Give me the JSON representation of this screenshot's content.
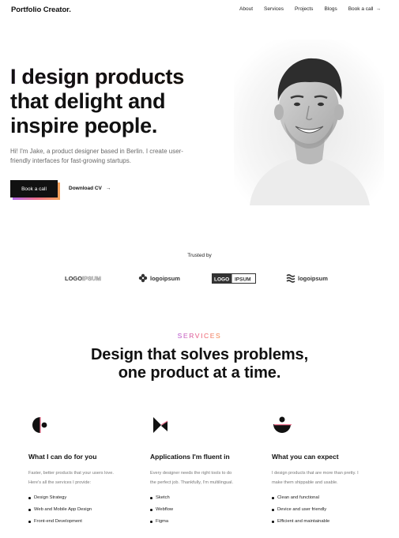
{
  "header": {
    "logo": "Portfolio Creator.",
    "nav": [
      "About",
      "Services",
      "Projects",
      "Blogs",
      "Book a call"
    ],
    "nav_cta_arrow": "→"
  },
  "hero": {
    "title_gradient": "I design products",
    "title_line2": "that delight and",
    "title_line3": "inspire people.",
    "subtitle": "Hi! I'm Jake, a product designer based in Berlin. I create user-friendly interfaces for fast-growing startups.",
    "primary_button": "Book a call",
    "secondary_button": "Download CV",
    "secondary_arrow": "→"
  },
  "trusted": {
    "label": "Trusted by",
    "logos": [
      "LOGOIPSUM",
      "logoipsum",
      "LOGO IPSUM",
      "logoipsum"
    ]
  },
  "services": {
    "eyebrow": "SERVICES",
    "title_line1": "Design that solves problems,",
    "title_line2": "one product at a time.",
    "columns": [
      {
        "icon": "half-circle-icon",
        "heading": "What I can do for you",
        "text": "Faster, better products that your users love. Here's all the services I provide:",
        "items": [
          "Design Strategy",
          "Web and Mobile App Design",
          "Front-end Development"
        ]
      },
      {
        "icon": "bowtie-icon",
        "heading": "Applications I'm fluent in",
        "text": "Every designer needs the right tools to do the perfect job. Thankfully, I'm multilingual.",
        "items": [
          "Sketch",
          "Webflow",
          "Figma"
        ]
      },
      {
        "icon": "bowl-icon",
        "heading": "What you can expect",
        "text": "I design products that are more than pretty. I make them shippable and usable.",
        "items": [
          "Clean and functional",
          "Device and user friendly",
          "Efficient and maintainable"
        ]
      }
    ]
  },
  "colors": {
    "gradient_start": "#b46be8",
    "gradient_mid": "#ef6f8d",
    "gradient_end": "#f5a45a",
    "text_dark": "#111111",
    "text_muted": "#6a6a6a"
  }
}
